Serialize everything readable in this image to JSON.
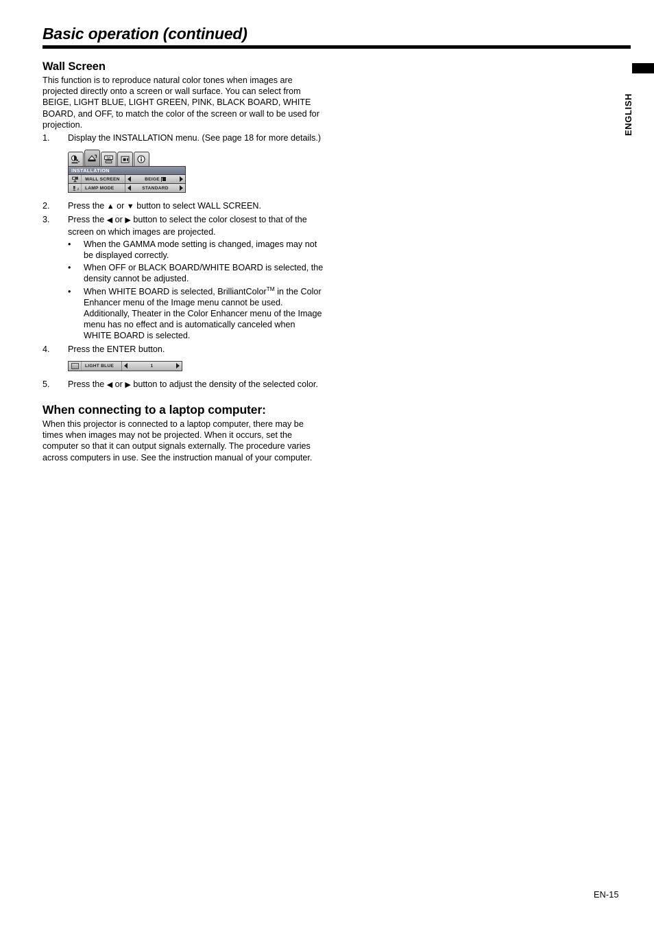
{
  "header": {
    "chapter_title": "Basic operation (continued)"
  },
  "side_tab": {
    "language_label": "ENGLISH"
  },
  "footer": {
    "page_number": "EN-15"
  },
  "sections": [
    {
      "heading": "Wall Screen",
      "intro": "This function is to reproduce natural color tones when images are projected directly onto a screen or wall surface. You can select from BEIGE, LIGHT BLUE, LIGHT GREEN, PINK, BLACK BOARD, WHITE BOARD, and OFF, to match the color of the screen or wall to be used for projection."
    },
    {
      "heading": "When connecting to a laptop computer:",
      "intro": "When this projector is connected to a laptop computer, there may be times when images may not be projected. When it occurs, set the computer so that it can output signals externally. The procedure varies across computers in use. See the instruction manual of your computer."
    }
  ],
  "steps": {
    "s1_num": "1.",
    "s1_text": "Display the INSTALLATION menu. (See page 18 for more details.)",
    "s2_num": "2.",
    "s2_a": "Press the",
    "s2_up": "▲",
    "s2_or": "or",
    "s2_down": "▼",
    "s2_b": "button to select WALL SCREEN.",
    "s3_num": "3.",
    "s3_a": "Press the",
    "s3_left": "◀",
    "s3_or": "or",
    "s3_right": "▶",
    "s3_b": "button to select the color closest to that of the screen on which images are projected.",
    "s4_num": "4.",
    "s4_text": "Press the ENTER button.",
    "s5_num": "5.",
    "s5_a": "Press the",
    "s5_left": "◀",
    "s5_or": "or",
    "s5_right": "▶",
    "s5_b": "button to adjust the density of the selected color."
  },
  "bullets": {
    "dot": "•",
    "b1": "When the GAMMA mode setting is changed, images may not be displayed correctly.",
    "b2": "When OFF or BLACK BOARD/WHITE BOARD is selected, the density cannot be adjusted.",
    "b3_a": "When WHITE BOARD is selected, BrilliantColor",
    "b3_tm": "TM",
    "b3_b": " in the Color Enhancer menu of the Image menu cannot be used. Additionally, Theater in the Color Enhancer menu of the Image menu has no effect and is automatically canceled when WHITE BOARD is selected."
  },
  "osd_menu": {
    "tabs": [
      {
        "name": "image-tab",
        "active": false
      },
      {
        "name": "installation-tab",
        "active": true
      },
      {
        "name": "feature-tab",
        "active": false
      },
      {
        "name": "signal-tab",
        "active": false
      },
      {
        "name": "information-tab",
        "active": false
      }
    ],
    "title": "INSTALLATION",
    "rows": [
      {
        "icon": "wall-screen-icon",
        "label": "WALL SCREEN",
        "value": "BEIGE",
        "has_enter_glyph": true
      },
      {
        "icon": "lamp-mode-icon",
        "label": "LAMP MODE",
        "value": "STANDARD",
        "has_enter_glyph": false
      }
    ]
  },
  "osd_single": {
    "icon": "color-swatch-icon",
    "label": "LIGHT BLUE",
    "value": "1"
  },
  "colors": {
    "rule": "#000000",
    "menu_title_bar": "#6d7486",
    "menu_body": "#c4c4c4"
  }
}
